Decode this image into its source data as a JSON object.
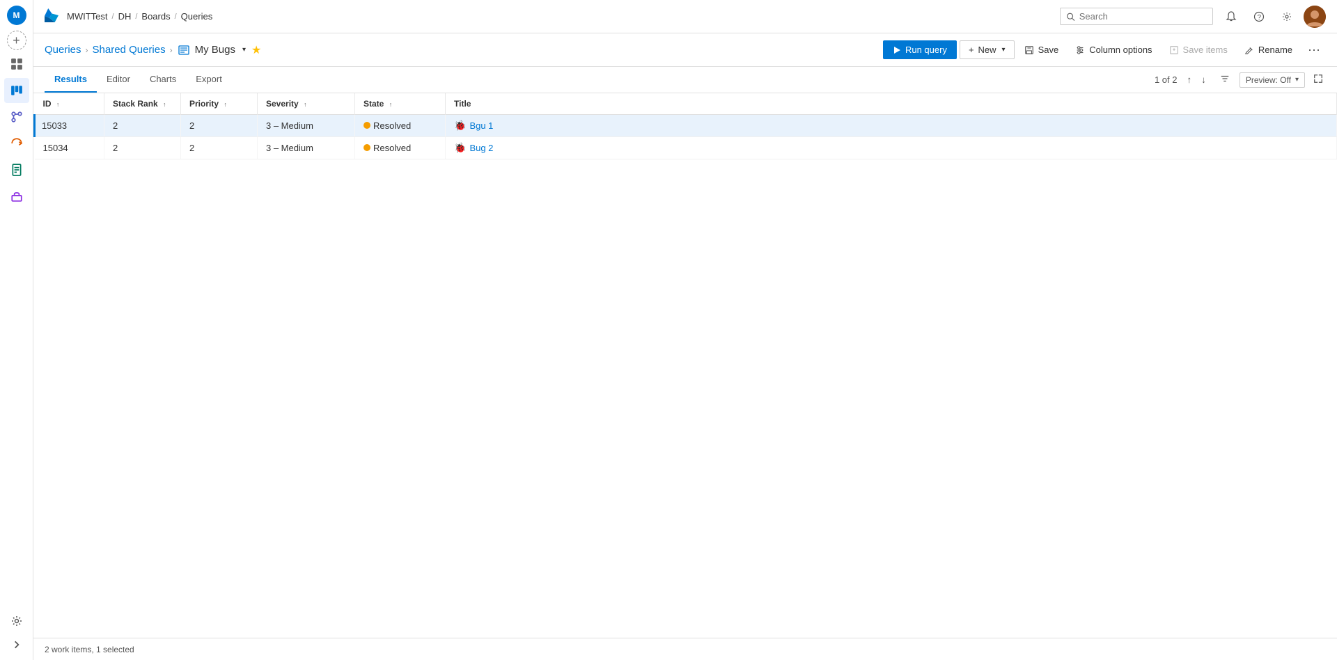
{
  "app": {
    "logo_initials": "M",
    "logo_title": "Azure DevOps"
  },
  "topbar": {
    "breadcrumb": [
      "MWITTest",
      "DH",
      "Boards",
      "Queries"
    ],
    "search_placeholder": "Search"
  },
  "content_header": {
    "breadcrumb_queries": "Queries",
    "breadcrumb_shared": "Shared Queries",
    "query_name": "My Bugs",
    "run_query_label": "Run query",
    "new_label": "New",
    "save_label": "Save",
    "column_options_label": "Column options",
    "save_items_label": "Save items",
    "rename_label": "Rename"
  },
  "tabs": {
    "items": [
      "Results",
      "Editor",
      "Charts",
      "Export"
    ],
    "active": "Results"
  },
  "pagination": {
    "text": "1 of 2"
  },
  "preview": {
    "label": "Preview: Off"
  },
  "columns": [
    {
      "key": "id",
      "label": "ID",
      "sort": "↑"
    },
    {
      "key": "stackRank",
      "label": "Stack Rank",
      "sort": "↑"
    },
    {
      "key": "priority",
      "label": "Priority",
      "sort": "↑"
    },
    {
      "key": "severity",
      "label": "Severity",
      "sort": "↑"
    },
    {
      "key": "state",
      "label": "State",
      "sort": "↑"
    },
    {
      "key": "title",
      "label": "Title",
      "sort": ""
    }
  ],
  "rows": [
    {
      "id": "15033",
      "stackRank": "2",
      "priority": "2",
      "severity": "3 – Medium",
      "state": "Resolved",
      "title": "Bgu 1",
      "selected": true
    },
    {
      "id": "15034",
      "stackRank": "2",
      "priority": "2",
      "severity": "3 – Medium",
      "state": "Resolved",
      "title": "Bug 2",
      "selected": false
    }
  ],
  "statusbar": {
    "count_text": "2 work items,",
    "selected_text": "1 selected"
  },
  "nav_icons": [
    {
      "name": "overview",
      "symbol": "🏠",
      "active": false
    },
    {
      "name": "boards",
      "symbol": "⊞",
      "active": true
    },
    {
      "name": "repos",
      "symbol": "⎇",
      "active": false
    },
    {
      "name": "pipelines",
      "symbol": "⟳",
      "active": false
    },
    {
      "name": "testplans",
      "symbol": "🧪",
      "active": false
    },
    {
      "name": "artifacts",
      "symbol": "📦",
      "active": false
    }
  ]
}
